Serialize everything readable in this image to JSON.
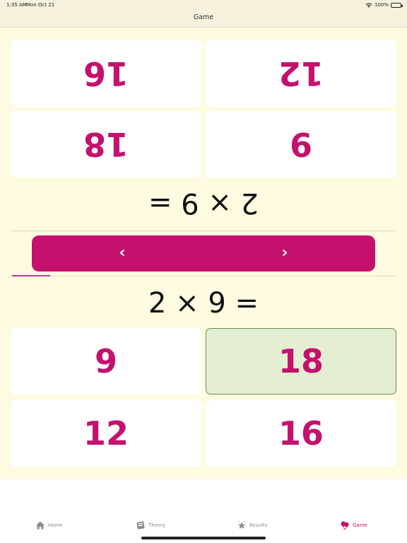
{
  "status_bar": {
    "time": "1:35 AM",
    "date": "Mon Oct 21",
    "battery": "100%"
  },
  "nav": {
    "title": "Game"
  },
  "top_player": {
    "answers": [
      "16",
      "12",
      "18",
      "9"
    ],
    "question": "2 × 9 ="
  },
  "bottom_player": {
    "question": "2 × 9 =",
    "answers": [
      "9",
      "18",
      "12",
      "16"
    ],
    "correct_answer": "18"
  },
  "controls": {
    "prev_icon": "chevron-left-icon",
    "next_icon": "chevron-right-icon"
  },
  "progress": {
    "fraction": 0.1
  },
  "tabs": [
    {
      "label": "Home",
      "icon": "house-icon"
    },
    {
      "label": "Theory",
      "icon": "book-icon"
    },
    {
      "label": "Results",
      "icon": "star-icon"
    },
    {
      "label": "Game",
      "icon": "balloons-icon",
      "active": true
    }
  ],
  "colors": {
    "accent": "#c4116e",
    "background": "#fefbe1",
    "correct_bg": "#e3eed2"
  }
}
